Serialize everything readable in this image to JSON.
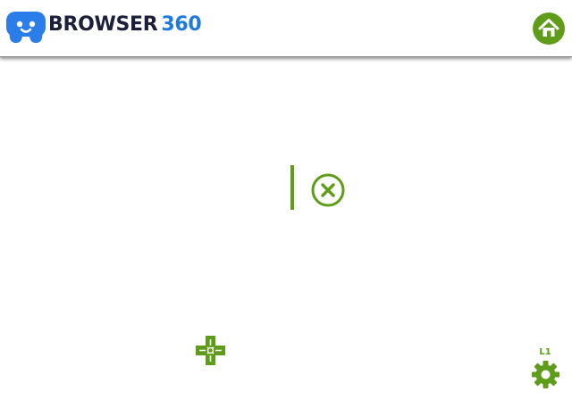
{
  "header": {
    "brand_word": "BROWSER",
    "brand_number": "360",
    "logo_icon": "gamepad-face-icon",
    "home_icon": "home-icon"
  },
  "main": {
    "cursor": "text-cursor",
    "close_icon": "close-circle-icon",
    "dpad_icon": "dpad-icon"
  },
  "footer": {
    "shoulder_label": "L1",
    "settings_icon": "gear-icon"
  },
  "colors": {
    "accent_green": "#5f9c1a",
    "brand_blue": "#1f7ae0",
    "brand_navy": "#1b1f3a",
    "logo_blue": "#2b7de9"
  }
}
